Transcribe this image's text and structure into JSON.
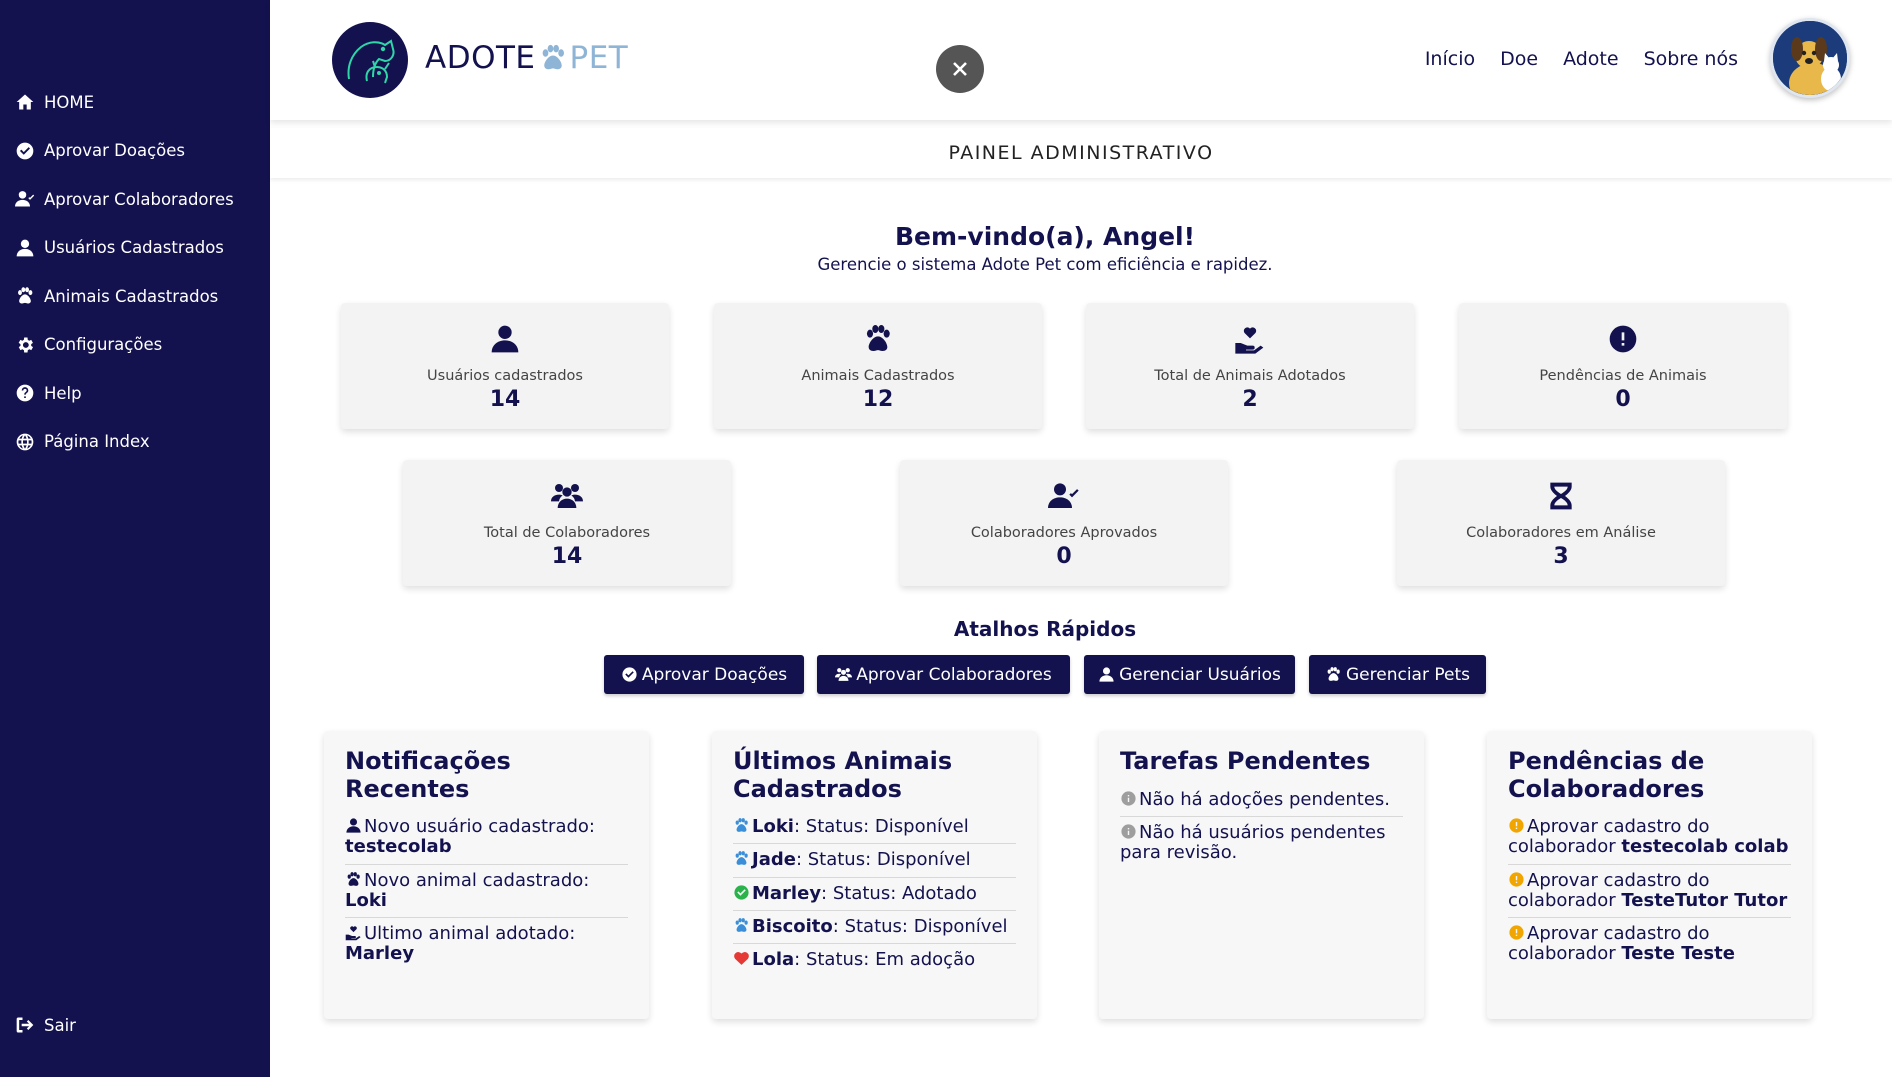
{
  "sidebar": {
    "items": [
      {
        "label": "HOME",
        "icon": "home-icon"
      },
      {
        "label": "Aprovar Doações",
        "icon": "check-circle-icon"
      },
      {
        "label": "Aprovar Colaboradores",
        "icon": "user-check-icon"
      },
      {
        "label": "Usuários Cadastrados",
        "icon": "user-icon"
      },
      {
        "label": "Animais Cadastrados",
        "icon": "paw-icon"
      },
      {
        "label": "Configurações",
        "icon": "gear-icon"
      },
      {
        "label": "Help",
        "icon": "question-circle-icon"
      },
      {
        "label": "Página Index",
        "icon": "globe-icon"
      }
    ],
    "logout": "Sair"
  },
  "header": {
    "logo_adote": "ADOTE",
    "logo_pet": "PET",
    "nav": [
      "Início",
      "Doe",
      "Adote",
      "Sobre nós"
    ]
  },
  "panel_title": "PAINEL ADMINISTRATIVO",
  "welcome": {
    "title": "Bem-vindo(a), Angel!",
    "subtitle": "Gerencie o sistema Adote Pet com eficiência e rapidez."
  },
  "stats": [
    {
      "label": "Usuários cadastrados",
      "value": "14",
      "icon": "user-icon"
    },
    {
      "label": "Animais Cadastrados",
      "value": "12",
      "icon": "paw-icon"
    },
    {
      "label": "Total de Animais Adotados",
      "value": "2",
      "icon": "hand-heart-icon"
    },
    {
      "label": "Pendências de Animais",
      "value": "0",
      "icon": "exclamation-circle-icon"
    },
    {
      "label": "Total de Colaboradores",
      "value": "14",
      "icon": "users-icon"
    },
    {
      "label": "Colaboradores Aprovados",
      "value": "0",
      "icon": "user-check-icon"
    },
    {
      "label": "Colaboradores em Análise",
      "value": "3",
      "icon": "hourglass-icon"
    }
  ],
  "shortcuts": {
    "title": "Atalhos Rápidos",
    "buttons": [
      {
        "label": "Aprovar Doações",
        "icon": "check-circle-icon"
      },
      {
        "label": "Aprovar Colaboradores",
        "icon": "users-icon"
      },
      {
        "label": "Gerenciar Usuários",
        "icon": "user-icon"
      },
      {
        "label": "Gerenciar Pets",
        "icon": "paw-icon"
      }
    ]
  },
  "notifications": {
    "title": "Notificações Recentes",
    "items": [
      {
        "text": "Novo usuário cadastrado:",
        "bold": "testecolab"
      },
      {
        "text": "Novo animal cadastrado:",
        "bold": "Loki"
      },
      {
        "text": "Ultimo animal adotado:",
        "bold": "Marley"
      }
    ]
  },
  "latest_animals": {
    "title": "Últimos Animais Cadastrados",
    "items": [
      {
        "name": "Loki",
        "status": ": Status: Disponível",
        "icon": "paw-icon",
        "color": "#3b8fd9"
      },
      {
        "name": "Jade",
        "status": ": Status: Disponível",
        "icon": "paw-icon",
        "color": "#3b8fd9"
      },
      {
        "name": "Marley",
        "status": ": Status: Adotado",
        "icon": "check-circle-icon",
        "color": "#2bb24c"
      },
      {
        "name": "Biscoito",
        "status": ": Status: Disponível",
        "icon": "paw-icon",
        "color": "#3b8fd9"
      },
      {
        "name": "Lola",
        "status": ": Status: Em adoção",
        "icon": "heart-icon",
        "color": "#e53935"
      }
    ]
  },
  "pending_tasks": {
    "title": "Tarefas Pendentes",
    "items": [
      "Não há adoções pendentes.",
      "Não há usuários pendentes para revisão."
    ]
  },
  "pending_collaborators": {
    "title": "Pendências de Colaboradores",
    "items": [
      {
        "text": "Aprovar cadastro do colaborador",
        "bold": "testecolab colab"
      },
      {
        "text": "Aprovar cadastro do colaborador",
        "bold": "TesteTutor Tutor"
      },
      {
        "text": "Aprovar cadastro do colaborador",
        "bold": "Teste Teste"
      }
    ]
  },
  "colors": {
    "primary": "#13124e",
    "card_bg": "#f3f3f3",
    "logo_accent": "#8fb5d6",
    "warning": "#f0a500",
    "info": "#9e9e9e"
  }
}
